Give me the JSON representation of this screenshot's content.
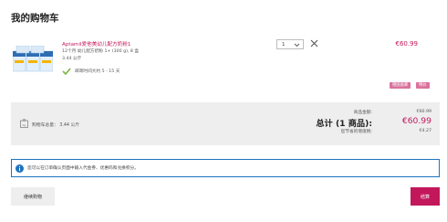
{
  "page": {
    "title": "我的购物车"
  },
  "item": {
    "name": "Aptamil爱他美幼儿配方奶粉1",
    "desc_line1": "12个月 幼儿配方奶粉 1+ (300 g), 8 盒",
    "desc_line2": "3.44 公斤",
    "delivery": "邮寄时间大约 5 - 15 天",
    "quantity": "1",
    "price": "€60.99",
    "badges": [
      "德国直邮",
      "特价"
    ]
  },
  "summary": {
    "cart_weight": "购物车总量： 3.44 公斤",
    "goods_total_label": "商品金额:",
    "goods_total_value": "€60.99",
    "total_label": "总计 (1 商品):",
    "total_value": "€60.99",
    "saved_label": "您节省的增值税:",
    "saved_value": "€4.27"
  },
  "notice": {
    "text": "您可以在订单确认页面中输入代金券、优惠码和兑换积分。"
  },
  "actions": {
    "continue_label": "继续购物",
    "checkout_label": "结算"
  },
  "icons": {
    "remove": "close-icon",
    "check": "check-icon",
    "info": "info-icon",
    "weight": "scale-icon",
    "chevron": "chevron-down-icon"
  },
  "colors": {
    "accent": "#c2185b",
    "badge": "#d9739c",
    "notice_border": "#1e73be",
    "check": "#7cb342"
  }
}
